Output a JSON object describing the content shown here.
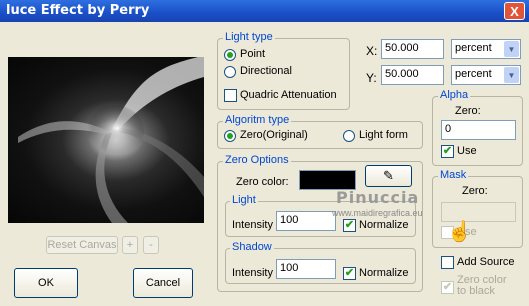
{
  "window": {
    "title": "luce Effect by Perry",
    "close_label": "X"
  },
  "preview": {
    "reset_canvas_label": "Reset Canvas",
    "plus_label": "+",
    "minus_label": "-"
  },
  "light_type": {
    "label": "Light type",
    "point_label": "Point",
    "directional_label": "Directional",
    "selected": "Point",
    "quadric_label": "Quadric Attenuation",
    "quadric_checked": false
  },
  "position": {
    "x_label": "X:",
    "x_value": "50.000",
    "x_unit": "percent",
    "y_label": "Y:",
    "y_value": "50.000",
    "y_unit": "percent"
  },
  "algorithm": {
    "label": "Algoritm type",
    "zero_label": "Zero(Original)",
    "light_form_label": "Light form",
    "selected": "Zero(Original)"
  },
  "zero_options": {
    "label": "Zero Options",
    "zero_color_label": "Zero color:",
    "zero_color": "#000000",
    "light": {
      "label": "Light",
      "intensity_label": "Intensity",
      "intensity_value": "100",
      "normalize_label": "Normalize",
      "normalize_checked": true
    },
    "shadow": {
      "label": "Shadow",
      "intensity_label": "Intensity",
      "intensity_value": "100",
      "normalize_label": "Normalize",
      "normalize_checked": true
    }
  },
  "alpha": {
    "label": "Alpha",
    "zero_label": "Zero:",
    "zero_value": "0",
    "use_label": "Use",
    "use_checked": true
  },
  "mask": {
    "label": "Mask",
    "zero_label": "Zero:",
    "zero_value": "",
    "use_label": "Use",
    "use_checked": false,
    "add_source_label": "Add Source",
    "add_source_checked": false,
    "zero_to_black_label": "Zero color to black",
    "zero_to_black_checked": true
  },
  "footer": {
    "ok_label": "OK",
    "cancel_label": "Cancel"
  },
  "watermark": {
    "line1": "Pinuccia",
    "line2": "www.maidiregrafica.eu"
  }
}
